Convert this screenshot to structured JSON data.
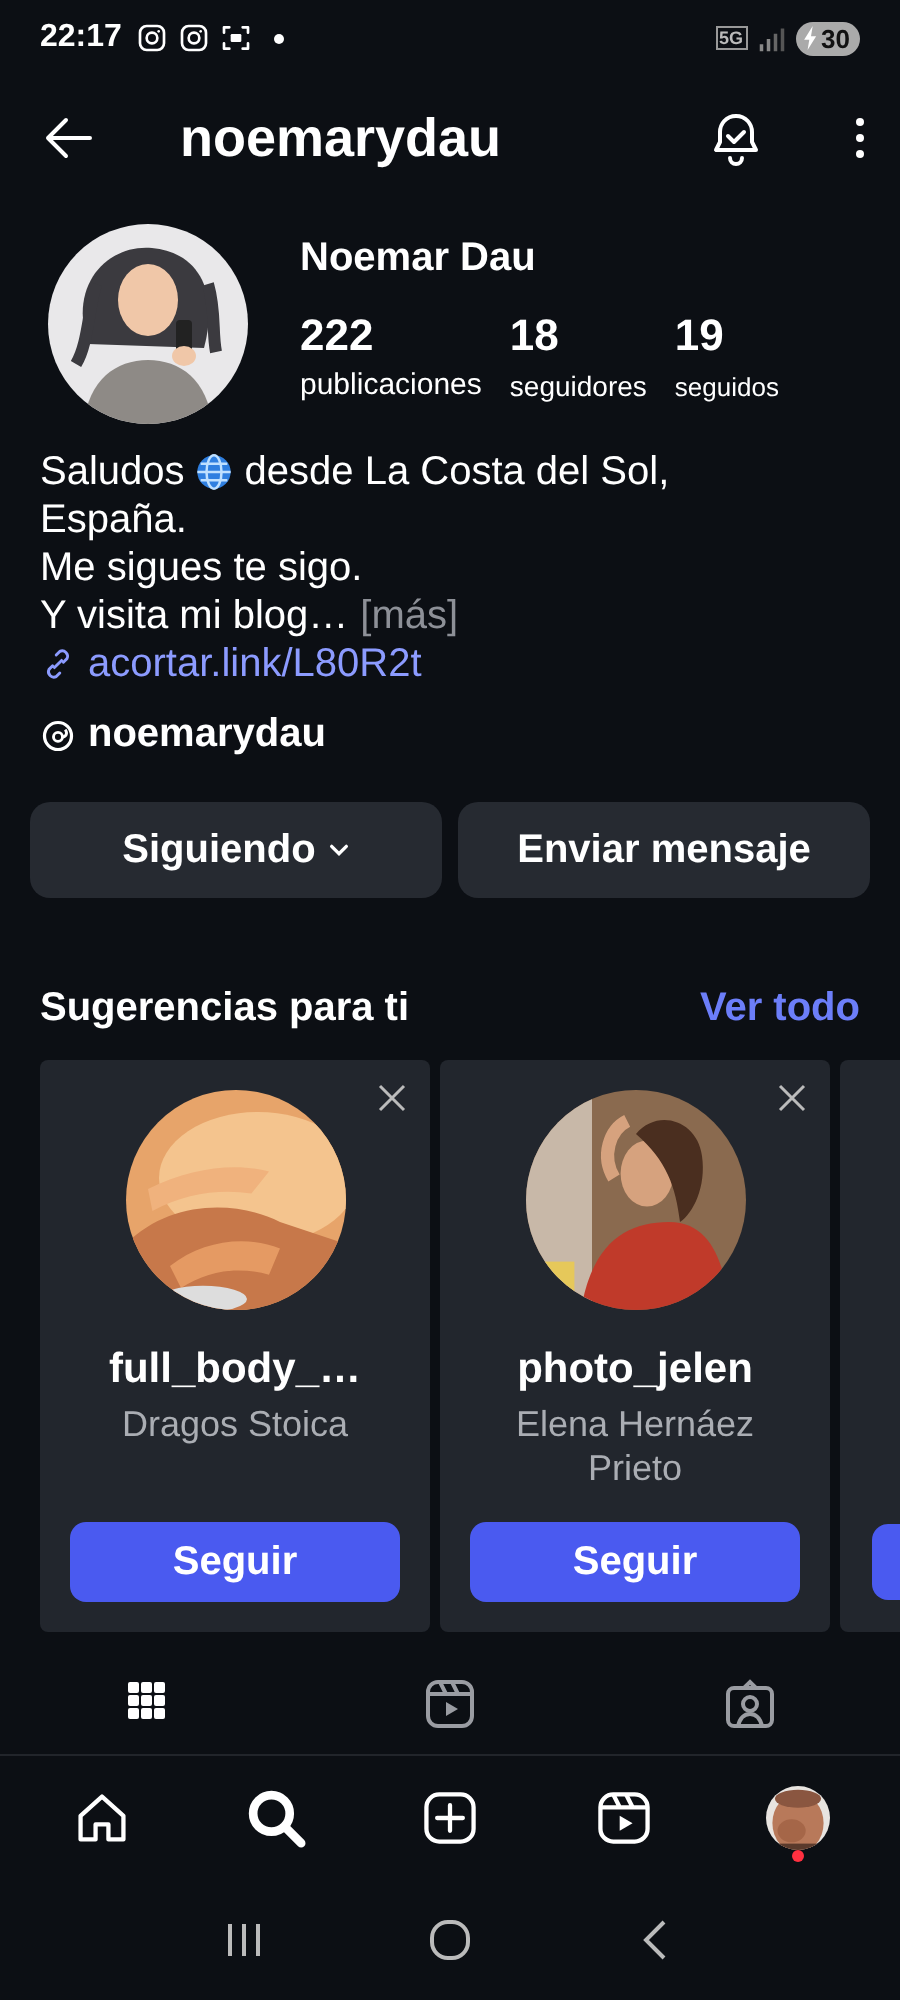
{
  "status_bar": {
    "time": "22:17",
    "network": "5G",
    "battery": "30"
  },
  "header": {
    "title": "noemarydau"
  },
  "profile": {
    "name": "Noemar Dau",
    "stats": [
      {
        "value": "222",
        "label": "publicaciones"
      },
      {
        "value": "18",
        "label": "seguidores"
      },
      {
        "value": "19",
        "label": "seguidos"
      }
    ]
  },
  "bio": {
    "greeting": "Saludos",
    "greeting_rest": "desde La Costa del Sol,",
    "lines": [
      "España.",
      "Me sigues te sigo."
    ],
    "last_line": "Y visita mi blog…",
    "more": "[más]",
    "link": "acortar.link/L80R2t",
    "threads_handle": "noemarydau"
  },
  "actions": [
    {
      "label": "Siguiendo",
      "dropdown": true
    },
    {
      "label": "Enviar mensaje",
      "dropdown": false
    }
  ],
  "suggestions": {
    "title": "Sugerencias para ti",
    "see_all": "Ver todo",
    "cards": [
      {
        "username": "full_body_…",
        "name": "Dragos Stoica",
        "button": "Seguir"
      },
      {
        "username": "photo_jelen",
        "name": "Elena Hernáez Prieto",
        "button": "Seguir"
      }
    ]
  },
  "profile_tabs": [
    {
      "kind": "grid",
      "selected": true
    },
    {
      "kind": "reels",
      "selected": false
    },
    {
      "kind": "tagged",
      "selected": false
    }
  ],
  "bottom_nav": [
    {
      "kind": "home",
      "selected": false
    },
    {
      "kind": "search",
      "selected": true
    },
    {
      "kind": "create",
      "selected": false
    },
    {
      "kind": "reels",
      "selected": false
    },
    {
      "kind": "profile",
      "selected": false,
      "badge": true
    }
  ]
}
